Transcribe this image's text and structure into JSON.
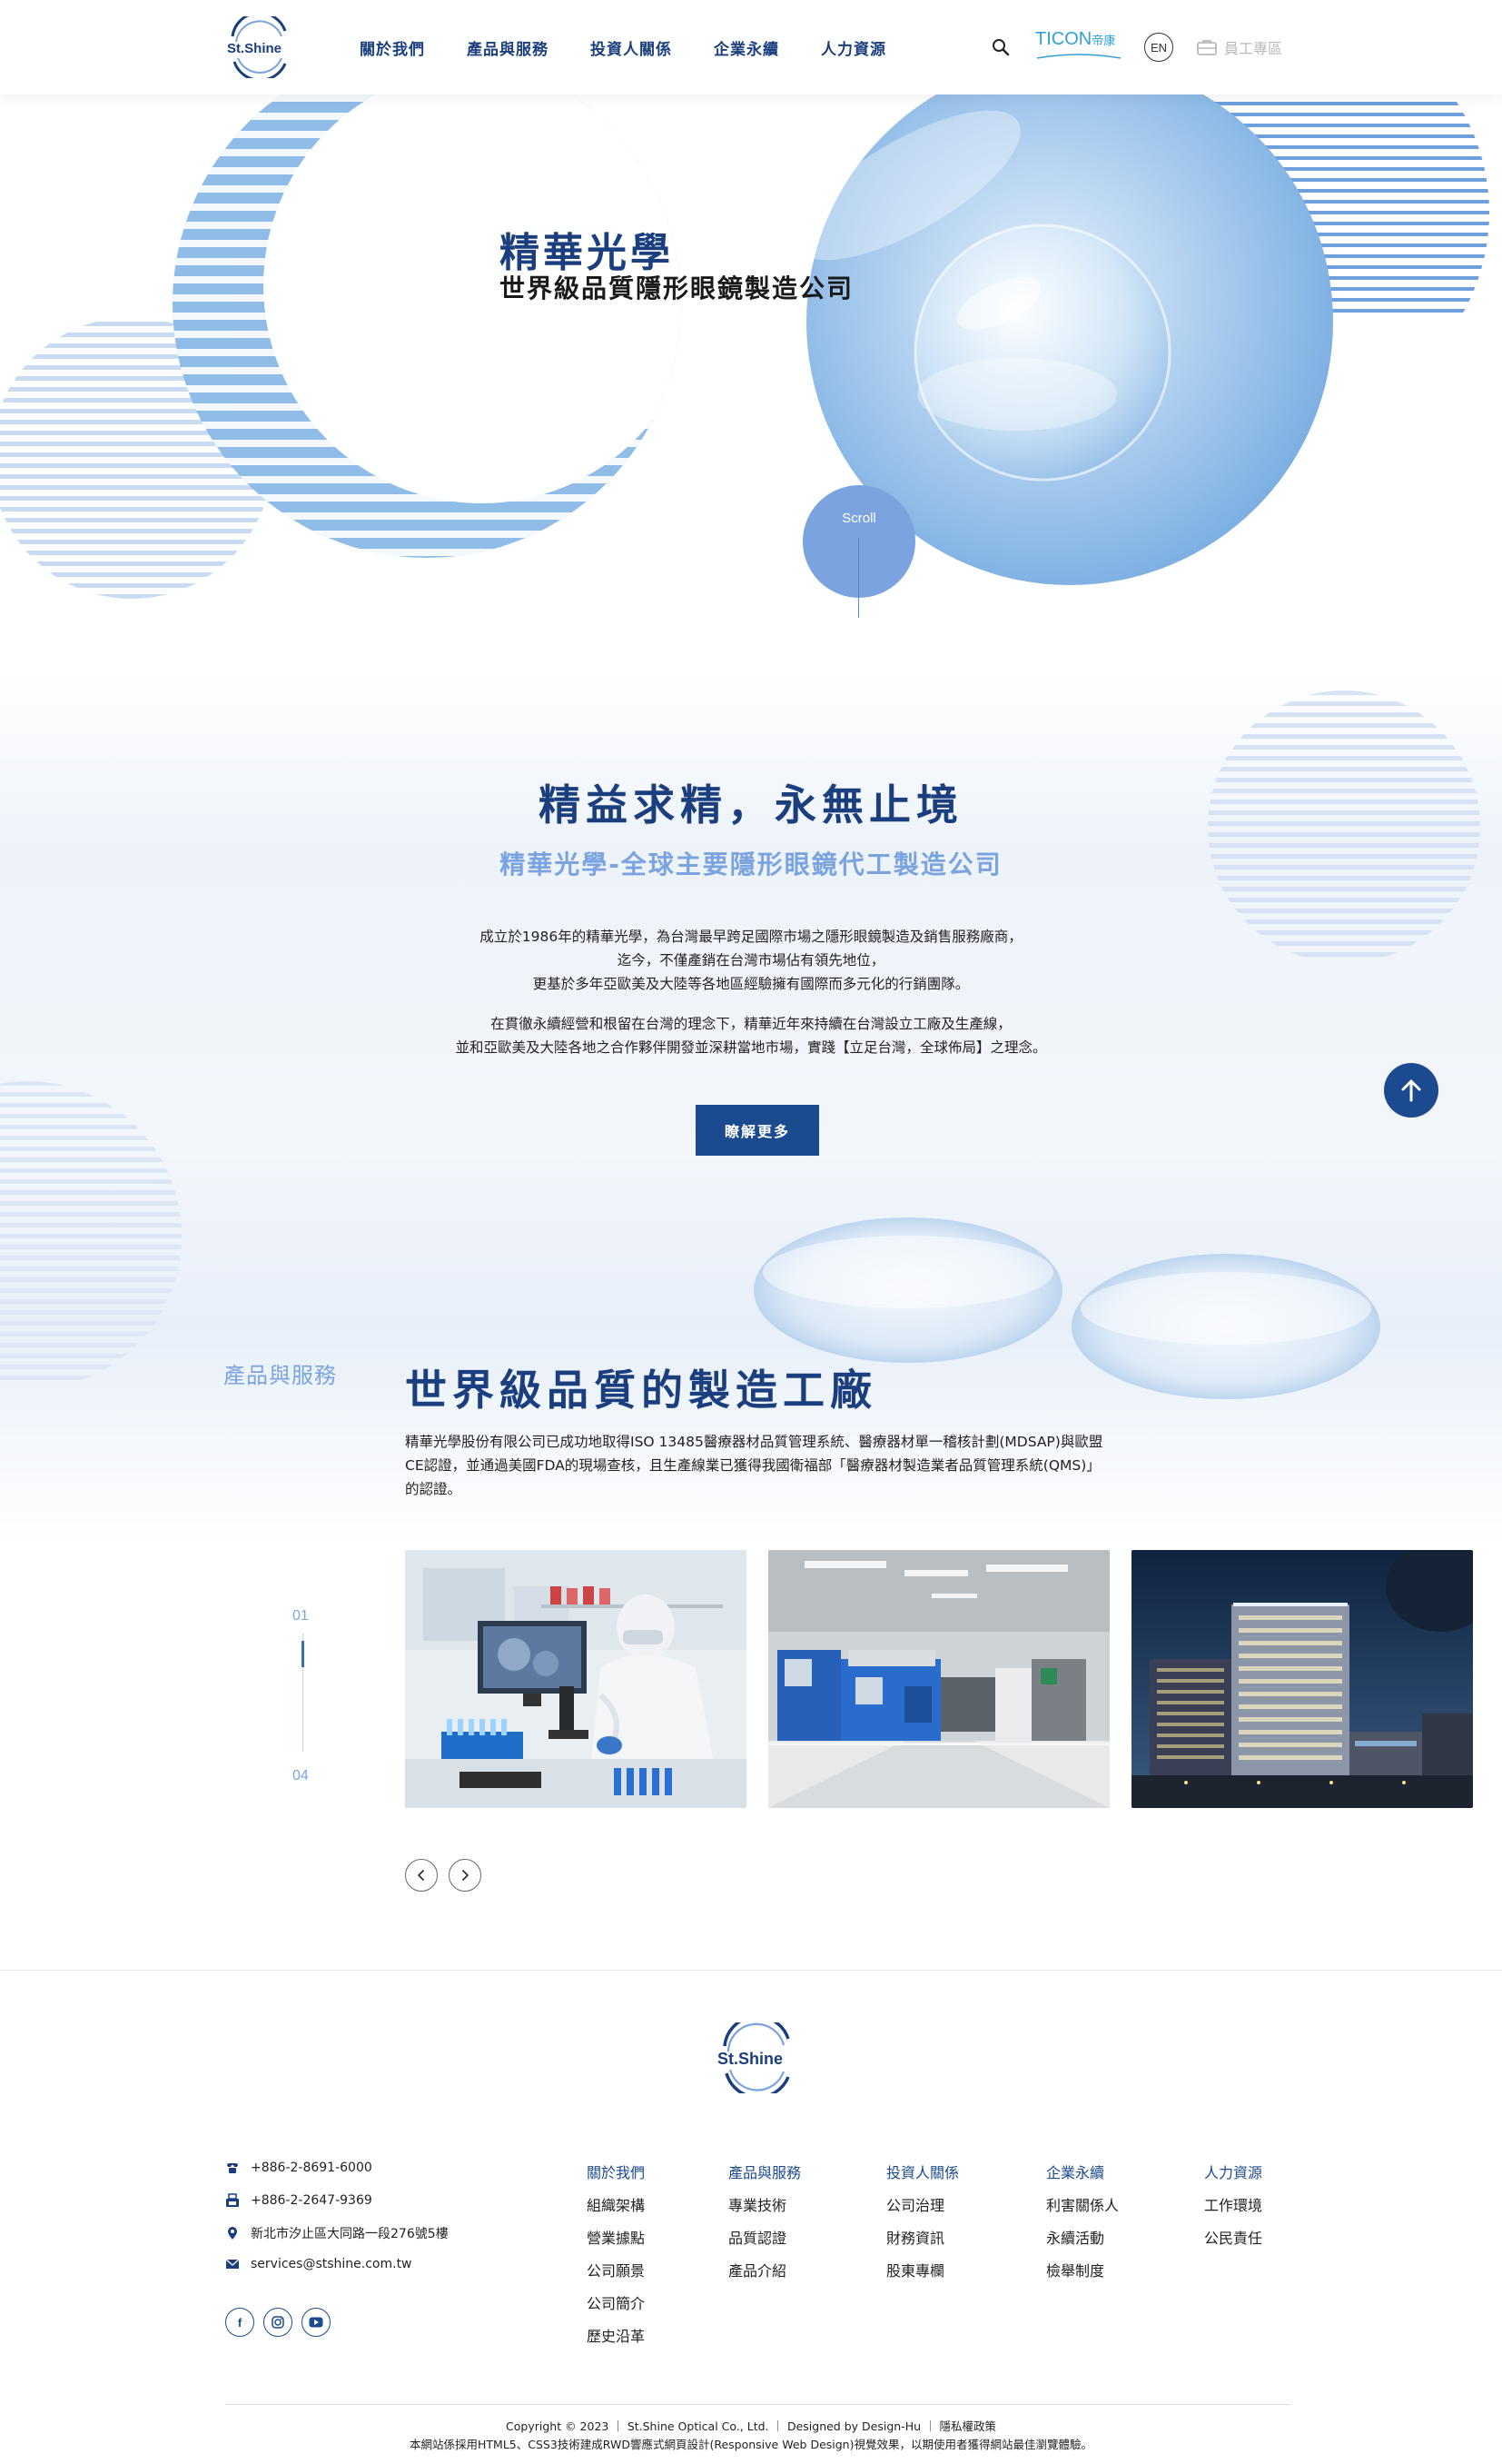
{
  "header": {
    "logo_text": "St.Shine",
    "nav": [
      "關於我們",
      "產品與服務",
      "投資人關係",
      "企業永續",
      "人力資源"
    ],
    "partner_brand": "TICON",
    "partner_brand_sub": "帝康",
    "lang_label": "EN",
    "staff_label": "員工專區"
  },
  "hero": {
    "title": "精華光學",
    "subtitle": "世界級品質隱形眼鏡製造公司",
    "scroll_label": "Scroll"
  },
  "intro": {
    "title": "精益求精，永無止境",
    "subtitle": "精華光學-全球主要隱形眼鏡代工製造公司",
    "paragraph1": [
      "成立於1986年的精華光學，為台灣最早跨足國際市場之隱形眼鏡製造及銷售服務廠商，",
      "迄今，不僅產銷在台灣市場佔有領先地位，",
      "更基於多年亞歐美及大陸等各地區經驗擁有國際而多元化的行銷團隊。"
    ],
    "paragraph2": [
      "在貫徹永續經營和根留在台灣的理念下，精華近年來持續在台灣設立工廠及生產線，",
      "並和亞歐美及大陸各地之合作夥伴開發並深耕當地市場，實踐【立足台灣，全球佈局】之理念。"
    ],
    "button_label": "瞭解更多"
  },
  "products": {
    "tag": "產品與服務",
    "title": "世界級品質的製造工廠",
    "description": "精華光學股份有限公司已成功地取得ISO 13485醫療器材品質管理系統、醫療器材單一稽核計劃(MDSAP)與歐盟CE認證，並通過美國FDA的現場查核，且生產線業已獲得我國衛福部「醫療器材製造業者品質管理系統(QMS)」的認證。",
    "pager_current": "01",
    "pager_total": "04",
    "slide_progress": 0.25,
    "cards": [
      "laboratory-photo",
      "factory-machines-photo",
      "office-building-night-photo"
    ]
  },
  "footer": {
    "logo_text": "St.Shine",
    "contacts": [
      {
        "icon": "phone-icon",
        "text": "+886-2-8691-6000"
      },
      {
        "icon": "fax-icon",
        "text": "+886-2-2647-9369"
      },
      {
        "icon": "location-icon",
        "text": "新北市汐止區大同路一段276號5樓"
      },
      {
        "icon": "mail-icon",
        "text": "services@stshine.com.tw"
      }
    ],
    "social": [
      "facebook-icon",
      "instagram-icon",
      "youtube-icon"
    ],
    "columns": [
      {
        "heading": "關於我們",
        "items": [
          "組織架構",
          "營業據點",
          "公司願景",
          "公司簡介",
          "歷史沿革"
        ]
      },
      {
        "heading": "產品與服務",
        "items": [
          "專業技術",
          "品質認證",
          "產品介紹"
        ]
      },
      {
        "heading": "投資人關係",
        "items": [
          "公司治理",
          "財務資訊",
          "股東專欄"
        ]
      },
      {
        "heading": "企業永續",
        "items": [
          "利害關係人",
          "永續活動",
          "檢舉制度"
        ]
      },
      {
        "heading": "人力資源",
        "items": [
          "工作環境",
          "公民責任"
        ]
      }
    ],
    "copyright": "Copyright © 2023 ｜ St.Shine Optical Co., Ltd. ｜ Designed by Design-Hu ｜ 隱私權政策",
    "tech_note": "本網站係採用HTML5、CSS3技術建成RWD響應式網頁設計(Responsive Web Design)視覺效果，以期使用者獲得網站最佳瀏覽體驗。"
  },
  "colors": {
    "brand_navy": "#1b3f7e",
    "accent_blue": "#7aa3e0",
    "button_blue": "#1b4a8f",
    "ticon_blue": "#2fa1d8"
  }
}
